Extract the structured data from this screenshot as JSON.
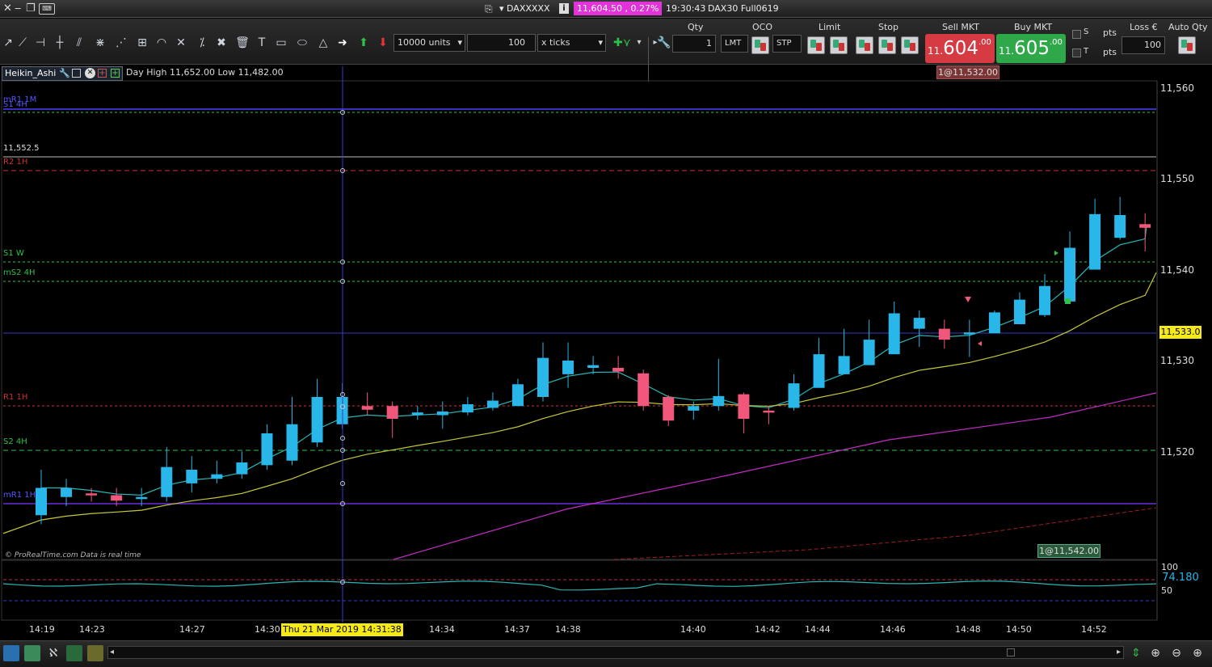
{
  "window": {
    "title_symbol": "DAXXXXX",
    "price_badge": "11,604.50 , 0.27%",
    "clock": "19:30:43",
    "instrument": "DAX30 Full0619"
  },
  "toolbar": {
    "units_value": "10000 units",
    "ticks_value": "100",
    "ticks_unit": "x ticks",
    "qty_label": "Qty",
    "qty_value": "1",
    "oco_label": "OCO",
    "lmt_label": "LMT",
    "stp_label": "STP",
    "limit_label": "Limit",
    "stop_label": "Stop",
    "sell_label": "Sell MKT",
    "buy_label": "Buy MKT",
    "sell_big": "11.",
    "sell_mid": "604",
    "sell_small": ".00",
    "buy_big": "11.",
    "buy_mid": "605",
    "buy_small": ".00",
    "s_label": "S",
    "t_label": "T",
    "pts1": "pts",
    "pts2": "pts",
    "loss_label": "Loss €",
    "auto_qty_label": "Auto Qty",
    "loss_value": "100"
  },
  "chart": {
    "name": "Heikin_Ashi",
    "day_info": "Day High 11,652.00 Low 11,482.00",
    "copyright": "© ProRealTime.com  Data is real time",
    "order_top": "1@11,532.00",
    "order_bottom": "1@11,542.00",
    "current_price": "11,533.0",
    "osc_value": "74.180",
    "osc_100": "100",
    "osc_50": "50",
    "crosshair_date": "Thu 21 Mar 2019 14:31:38"
  },
  "levels": {
    "mr1": "mR1 1M",
    "s14h": "S1 4H",
    "line552": "11,552.5",
    "r21h": "R2 1H",
    "s1w": "S1 W",
    "ms24h": "mS2 4H",
    "r11h": "R1 1H",
    "s24h": "S2 4H",
    "mr11h": "mR1 1H"
  },
  "colors": {
    "up": "#29b6e8",
    "down": "#f0577a",
    "ma_fast": "#27b7b7",
    "ma_mid": "#c8c83a",
    "ma_slow": "#c52bc5",
    "ma_long": "#a11f1f"
  },
  "chart_data": {
    "type": "candlestick",
    "y_ticks": [
      "11,560",
      "11,550",
      "11,540",
      "11,530",
      "11,520"
    ],
    "y_values": [
      11560,
      11550,
      11540,
      11530,
      11520
    ],
    "x_labels": [
      "14:19",
      "14:23",
      "14:27",
      "14:30",
      "14:34",
      "14:37",
      "14:38",
      "14:40",
      "14:42",
      "14:44",
      "14:46",
      "14:48",
      "14:50",
      "14:52"
    ],
    "candles": [
      {
        "o": 11513,
        "c": 11516,
        "h": 11518,
        "l": 11512
      },
      {
        "o": 11515,
        "c": 11516,
        "h": 11517,
        "l": 11514
      },
      {
        "o": 11515.4,
        "c": 11515.2,
        "h": 11516,
        "l": 11514.5
      },
      {
        "o": 11515.2,
        "c": 11514.6,
        "h": 11516,
        "l": 11514
      },
      {
        "o": 11514.8,
        "c": 11515,
        "h": 11516,
        "l": 11514
      },
      {
        "o": 11515,
        "c": 11518.3,
        "h": 11520.5,
        "l": 11514.5
      },
      {
        "o": 11516.5,
        "c": 11518,
        "h": 11519.5,
        "l": 11515.5
      },
      {
        "o": 11517,
        "c": 11517.5,
        "h": 11519,
        "l": 11516.5
      },
      {
        "o": 11517.5,
        "c": 11518.8,
        "h": 11520,
        "l": 11517
      },
      {
        "o": 11518.5,
        "c": 11522,
        "h": 11523,
        "l": 11518
      },
      {
        "o": 11519,
        "c": 11523,
        "h": 11526,
        "l": 11518.5
      },
      {
        "o": 11521,
        "c": 11526,
        "h": 11528,
        "l": 11520.5
      },
      {
        "o": 11523,
        "c": 11526,
        "h": 11527.5,
        "l": 11522.5
      },
      {
        "o": 11525,
        "c": 11524.6,
        "h": 11526.5,
        "l": 11524
      },
      {
        "o": 11525,
        "c": 11523.6,
        "h": 11525.5,
        "l": 11521.5
      },
      {
        "o": 11524,
        "c": 11524.3,
        "h": 11525,
        "l": 11523.5
      },
      {
        "o": 11524,
        "c": 11524.4,
        "h": 11525.5,
        "l": 11522.5
      },
      {
        "o": 11524.3,
        "c": 11525.2,
        "h": 11526,
        "l": 11524
      },
      {
        "o": 11524.8,
        "c": 11525.6,
        "h": 11526.5,
        "l": 11524.5
      },
      {
        "o": 11525,
        "c": 11527.4,
        "h": 11528,
        "l": 11525
      },
      {
        "o": 11526,
        "c": 11530.3,
        "h": 11532,
        "l": 11525.5
      },
      {
        "o": 11528.5,
        "c": 11530,
        "h": 11532,
        "l": 11527
      },
      {
        "o": 11529.2,
        "c": 11529.5,
        "h": 11530.5,
        "l": 11528.5
      },
      {
        "o": 11529.2,
        "c": 11528.8,
        "h": 11530.5,
        "l": 11528
      },
      {
        "o": 11528.6,
        "c": 11525,
        "h": 11529,
        "l": 11524.5
      },
      {
        "o": 11526,
        "c": 11523.4,
        "h": 11526.2,
        "l": 11522.8
      },
      {
        "o": 11524.5,
        "c": 11525,
        "h": 11525.5,
        "l": 11523.5
      },
      {
        "o": 11525,
        "c": 11526.1,
        "h": 11530.2,
        "l": 11524.5
      },
      {
        "o": 11526.3,
        "c": 11523.6,
        "h": 11526.5,
        "l": 11522
      },
      {
        "o": 11524.5,
        "c": 11524.4,
        "h": 11525,
        "l": 11523
      },
      {
        "o": 11524.8,
        "c": 11527.5,
        "h": 11528.5,
        "l": 11524.5
      },
      {
        "o": 11527,
        "c": 11530.7,
        "h": 11532.5,
        "l": 11527
      },
      {
        "o": 11528.5,
        "c": 11530.5,
        "h": 11533.5,
        "l": 11528.5
      },
      {
        "o": 11529.5,
        "c": 11532.3,
        "h": 11534.5,
        "l": 11529.5
      },
      {
        "o": 11530.7,
        "c": 11535.2,
        "h": 11536.5,
        "l": 11530.7
      },
      {
        "o": 11533.5,
        "c": 11534.7,
        "h": 11535.5,
        "l": 11531.5
      },
      {
        "o": 11533.5,
        "c": 11532.3,
        "h": 11534.5,
        "l": 11531.3
      },
      {
        "o": 11533,
        "c": 11533.1,
        "h": 11534.5,
        "l": 11530.4
      },
      {
        "o": 11533,
        "c": 11535.3,
        "h": 11535.5,
        "l": 11533
      },
      {
        "o": 11534,
        "c": 11536.7,
        "h": 11537.5,
        "l": 11534
      },
      {
        "o": 11535,
        "c": 11538.2,
        "h": 11539.5,
        "l": 11534.8
      },
      {
        "o": 11536.5,
        "c": 11542.4,
        "h": 11544.2,
        "l": 11536.3
      },
      {
        "o": 11540,
        "c": 11546.1,
        "h": 11547.8,
        "l": 11540
      },
      {
        "o": 11543.5,
        "c": 11546,
        "h": 11548,
        "l": 11543.3
      },
      {
        "o": 11545,
        "c": 11544.6,
        "h": 11546.2,
        "l": 11542
      }
    ]
  }
}
